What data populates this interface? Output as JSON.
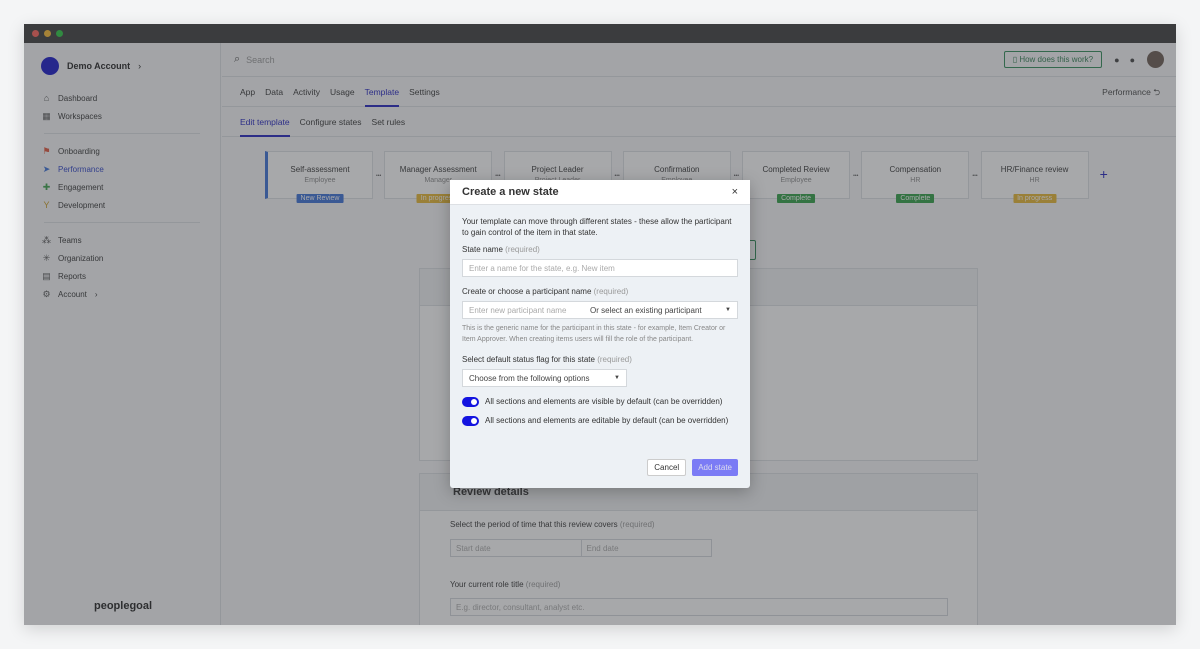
{
  "sidebar": {
    "account": "Demo Account",
    "items": [
      {
        "label": "Dashboard",
        "icon": "home-icon"
      },
      {
        "label": "Workspaces",
        "icon": "grid-icon"
      },
      {
        "label": "Onboarding",
        "icon": "flag-icon"
      },
      {
        "label": "Performance",
        "icon": "send-icon"
      },
      {
        "label": "Engagement",
        "icon": "puzzle-icon"
      },
      {
        "label": "Development",
        "icon": "sprout-icon"
      },
      {
        "label": "Teams",
        "icon": "org-chart-icon"
      },
      {
        "label": "Organization",
        "icon": "network-icon"
      },
      {
        "label": "Reports",
        "icon": "report-icon"
      },
      {
        "label": "Account",
        "icon": "gear-icon"
      }
    ],
    "brand": "peoplegoal"
  },
  "topbar": {
    "search_placeholder": "Search",
    "help": "How does this work?"
  },
  "tabs": [
    "App",
    "Data",
    "Activity",
    "Usage",
    "Template",
    "Settings"
  ],
  "active_tab": "Template",
  "breadcrumb_right": "Performance",
  "subtabs": [
    "Edit template",
    "Configure states",
    "Set rules"
  ],
  "states": [
    {
      "name": "Self-assessment",
      "role": "Employee",
      "badge": "New Review",
      "color": "#3a6fd8"
    },
    {
      "name": "Manager Assessment",
      "role": "Manager",
      "badge": "In progress",
      "color": "#e8b730"
    },
    {
      "name": "Project Leader",
      "role": "Project Leader",
      "badge": "",
      "color": ""
    },
    {
      "name": "Confirmation",
      "role": "Employee",
      "badge": "",
      "color": ""
    },
    {
      "name": "Completed Review",
      "role": "Employee",
      "badge": "Complete",
      "color": "#2e9e44"
    },
    {
      "name": "Compensation",
      "role": "HR",
      "badge": "Complete",
      "color": "#2e9e44"
    },
    {
      "name": "HR/Finance review",
      "role": "HR",
      "badge": "In progress",
      "color": "#e8b730"
    }
  ],
  "review": {
    "title": "Review details",
    "period_label": "Select the period of time that this review covers",
    "required": "(required)",
    "start": "Start date",
    "end": "End date",
    "role_label": "Your current role title",
    "role_placeholder": "E.g. director, consultant, analyst etc."
  },
  "modal": {
    "title": "Create a new state",
    "intro": "Your template can move through different states - these allow the participant to gain control of the item in that state.",
    "state_label": "State name",
    "required": "(required)",
    "state_placeholder": "Enter a name for the state, e.g. New item",
    "participant_label": "Create or choose a participant name",
    "participant_placeholder": "Enter new participant name",
    "participant_select": "Or select an existing participant",
    "participant_hint": "This is the generic name for the participant in this state - for example, Item Creator or Item Approver. When creating items users will fill the role of the participant.",
    "status_label": "Select default status flag for this state",
    "status_select": "Choose from the following options",
    "toggle_visible": "All sections and elements are visible by default (can be overridden)",
    "toggle_visible_on": true,
    "toggle_editable": "All sections and elements are editable by default (can be overridden)",
    "toggle_editable_on": true,
    "cancel": "Cancel",
    "add": "Add state"
  }
}
